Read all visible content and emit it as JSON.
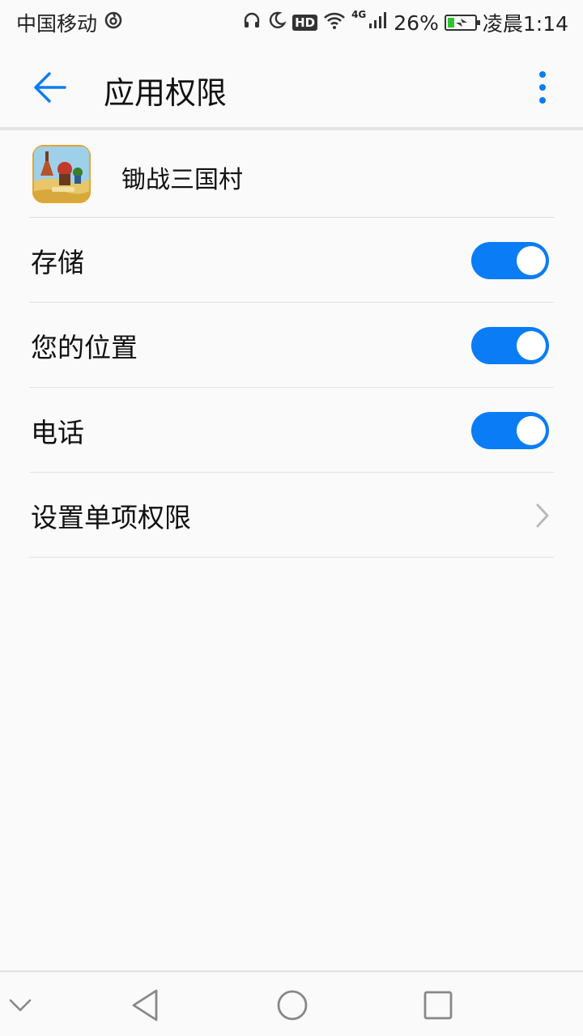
{
  "status_bar": {
    "carrier": "中国移动",
    "network": "4G",
    "battery_percent": "26%",
    "battery_level": 0.26,
    "time": "凌晨1:14",
    "hd_label": "HD",
    "icons": [
      "netease-icon",
      "headphones-icon",
      "moon-icon",
      "hd-icon",
      "wifi-icon",
      "signal-icon",
      "battery-icon"
    ]
  },
  "app_bar": {
    "title": "应用权限",
    "back_icon": "arrow-left-icon",
    "menu_icon": "more-vert-icon"
  },
  "app": {
    "name": "锄战三国村",
    "icon": "game-app-icon"
  },
  "permissions": [
    {
      "label": "存储",
      "enabled": true
    },
    {
      "label": "您的位置",
      "enabled": true
    },
    {
      "label": "电话",
      "enabled": true
    }
  ],
  "individual_permissions": {
    "label": "设置单项权限",
    "icon": "chevron-right-icon"
  },
  "nav_bar": {
    "icons": [
      "collapse-down-icon",
      "back-triangle-icon",
      "home-circle-icon",
      "recents-square-icon"
    ]
  },
  "colors": {
    "accent": "#0a7cf5",
    "background": "#fafafa"
  }
}
